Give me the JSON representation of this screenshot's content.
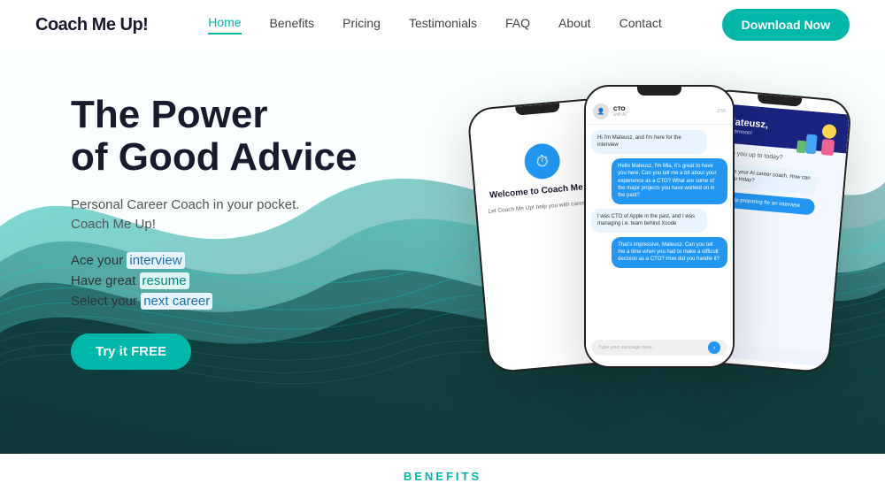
{
  "header": {
    "logo": "Coach Me Up!",
    "nav": [
      {
        "label": "Home",
        "active": true
      },
      {
        "label": "Benefits",
        "active": false
      },
      {
        "label": "Pricing",
        "active": false
      },
      {
        "label": "Testimonials",
        "active": false
      },
      {
        "label": "FAQ",
        "active": false
      },
      {
        "label": "About",
        "active": false
      },
      {
        "label": "Contact",
        "active": false
      }
    ],
    "download_button": "Download Now"
  },
  "hero": {
    "title_line1": "The Power",
    "title_line2": "of Good Advice",
    "subtitle_line1": "Personal Career Coach in your pocket.",
    "subtitle_line2": "Coach Me Up!",
    "features": [
      {
        "prefix": "Ace your ",
        "highlight": "interview"
      },
      {
        "prefix": "Have great ",
        "highlight": "resume"
      },
      {
        "prefix": "Select your ",
        "highlight": "next career"
      }
    ],
    "cta_button": "Try it FREE"
  },
  "phones": {
    "left": {
      "title": "Welcome to Coach Me Up!",
      "subtitle": "Let Coach Me Up! help you with career goals."
    },
    "center": {
      "contact": "CTO",
      "time": "2:58",
      "messages": [
        {
          "type": "bot",
          "text": "Hi I'm Mateusz, and I'm here for the interview"
        },
        {
          "type": "user",
          "text": "Hello Mateusz, I'm Mia, it's great to have you here. Can you tell me a bit about your experience as a CTO? What are some of the major projects you have worked on in the past?"
        },
        {
          "type": "bot",
          "text": "I was CTO of Apple in the past, and I was managing i.e. team behind Xcode"
        },
        {
          "type": "user",
          "text": "That's impressive, Mateusz. Can you tell me a time when you had to make a difficult decision as a CTO? How did you handle it?"
        }
      ],
      "input_placeholder": "Type your message here..."
    },
    "right": {
      "greeting": "Hi Mateusz,",
      "subtext": "Good afternoon!",
      "question": "What are you up to today?"
    }
  },
  "benefits": {
    "label": "BENEFITS"
  }
}
